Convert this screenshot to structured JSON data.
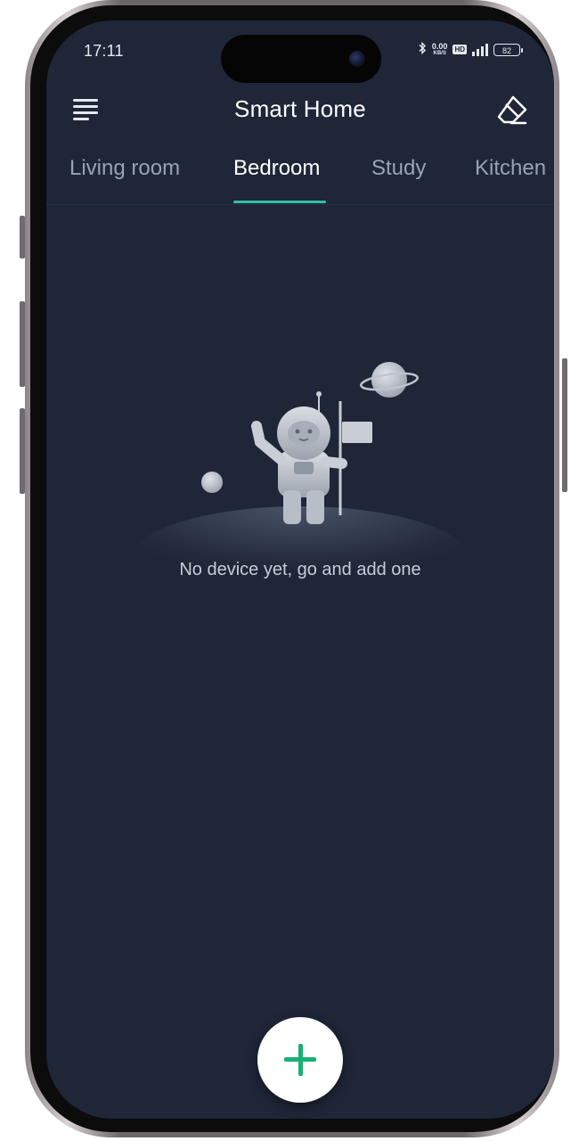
{
  "status_bar": {
    "time": "17:11",
    "network_speed_top": "0.00",
    "network_speed_bottom": "KB/S",
    "hd_label": "HD",
    "battery": "82"
  },
  "header": {
    "title": "Smart Home",
    "menu_icon": "menu-list-icon",
    "eraser_icon": "eraser-icon"
  },
  "tabs": [
    {
      "label": "Living room",
      "active": false
    },
    {
      "label": "Bedroom",
      "active": true
    },
    {
      "label": "Study",
      "active": false
    },
    {
      "label": "Kitchen",
      "active": false
    }
  ],
  "empty_state": {
    "message": "No device yet, go and add one",
    "illustration": "astronaut-with-flag-icon"
  },
  "fab": {
    "icon": "plus-icon"
  },
  "colors": {
    "background": "#1e2638",
    "accent": "#33c0a4",
    "fab_plus": "#18b072",
    "tab_inactive": "#9aa3b3",
    "text_primary": "#ffffff"
  }
}
